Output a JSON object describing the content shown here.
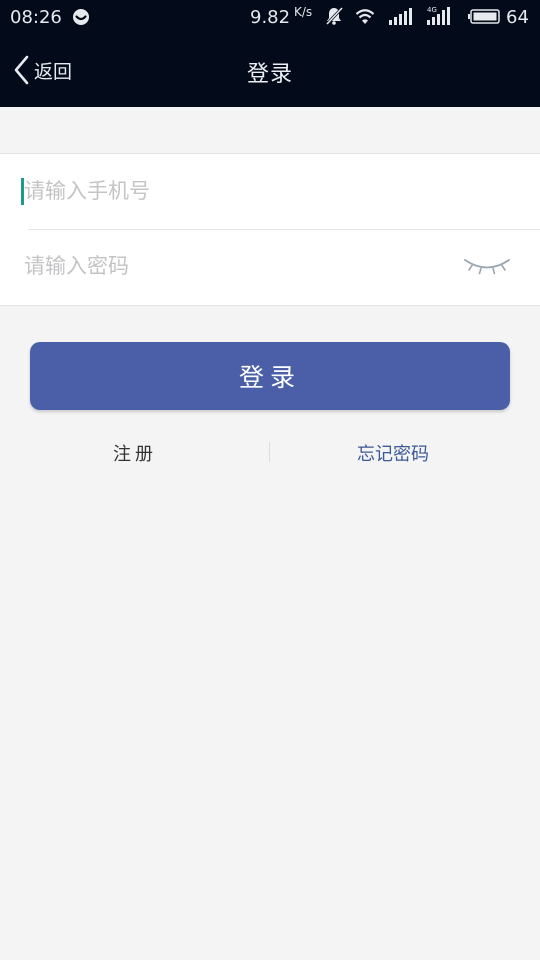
{
  "status_bar": {
    "time": "08:26",
    "net_speed": "9.82",
    "net_speed_unit": "K/s",
    "network_type": "4G",
    "battery_level": "64"
  },
  "header": {
    "back_label": "返回",
    "title": "登录"
  },
  "form": {
    "phone_placeholder": "请输入手机号",
    "password_placeholder": "请输入密码"
  },
  "login_button": {
    "label": "登录"
  },
  "links": {
    "register": "注册",
    "forgot_password": "忘记密码"
  },
  "icons": {
    "back": "chevron-left-icon",
    "password_visibility": "eye-closed-icon",
    "status_app": "notification-app-icon",
    "mute": "bell-muted-icon",
    "wifi": "wifi-icon",
    "signal": "cell-signal-icon",
    "battery": "battery-icon"
  },
  "colors": {
    "header_bg": "#030b1a",
    "page_bg": "#f4f4f5",
    "primary_button": "#4a5fa8",
    "link_accent": "#3c5998",
    "caret": "#1a9b8c"
  }
}
